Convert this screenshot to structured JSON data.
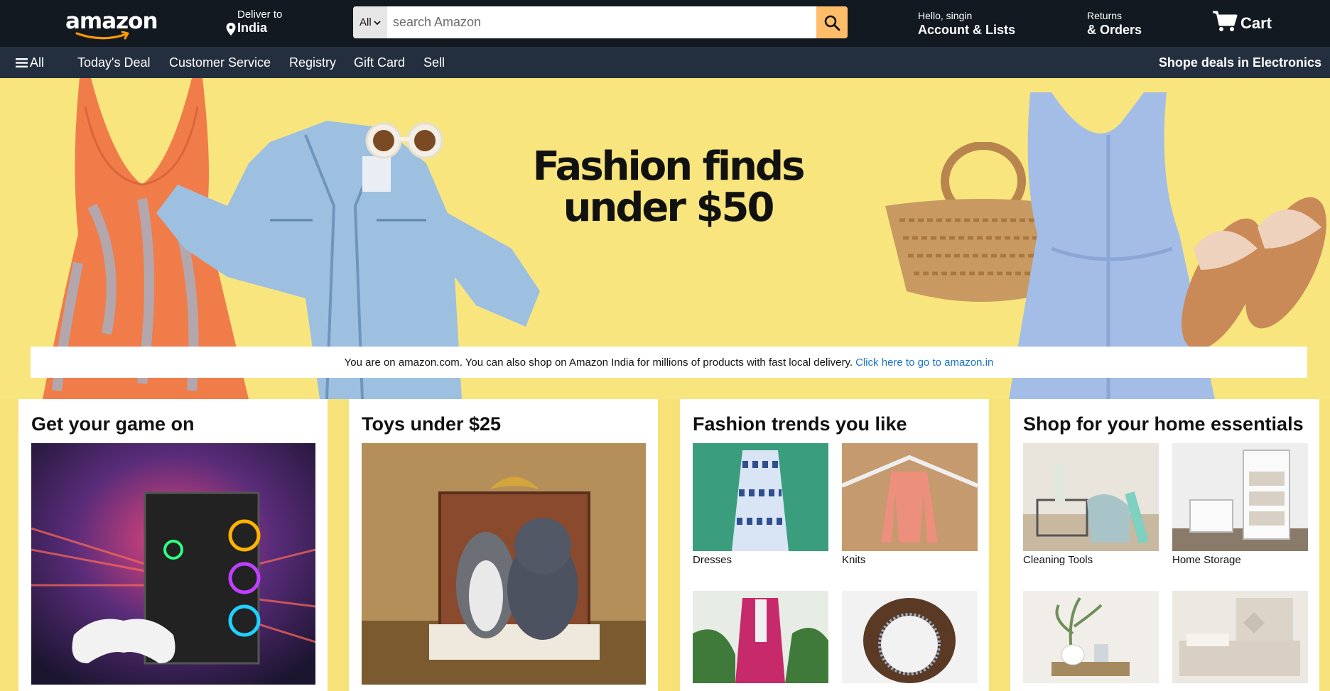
{
  "header": {
    "logo": "amazon",
    "deliver_to_label": "Deliver to",
    "deliver_to_location": "India",
    "search": {
      "category": "All",
      "placeholder": "search Amazon"
    },
    "account_greeting": "Hello, singin",
    "account_label": "Account & Lists",
    "returns_label": "Returns",
    "orders_label": "& Orders",
    "cart_label": "Cart"
  },
  "nav": {
    "all_label": "All",
    "items": [
      "Today's Deal",
      "Customer Service",
      "Registry",
      "Gift Card",
      "Sell"
    ],
    "right_label": "Shope deals in Electronics"
  },
  "hero": {
    "title_line1": "Fashion finds",
    "title_line2": "under $50"
  },
  "notice": {
    "text": "You are on amazon.com. You can also shop on Amazon India for millions of products with fast local delivery.",
    "link": "Click here to go to amazon.in"
  },
  "cards": [
    {
      "title": "Get your game on"
    },
    {
      "title": "Toys under $25"
    },
    {
      "title": "Fashion trends you like",
      "tiles": [
        "Dresses",
        "Knits",
        "",
        ""
      ]
    },
    {
      "title": "Shop for your home essentials",
      "tiles": [
        "Cleaning Tools",
        "Home Storage",
        "",
        ""
      ]
    }
  ],
  "colors": {
    "header_bg": "#131921",
    "nav_bg": "#232f3e",
    "search_button": "#febd69",
    "hero_bg": "#f8e57e",
    "link": "#1a73c9"
  },
  "icons": [
    "location-pin-icon",
    "search-icon",
    "cart-icon",
    "menu-icon",
    "chevron-down-icon"
  ]
}
